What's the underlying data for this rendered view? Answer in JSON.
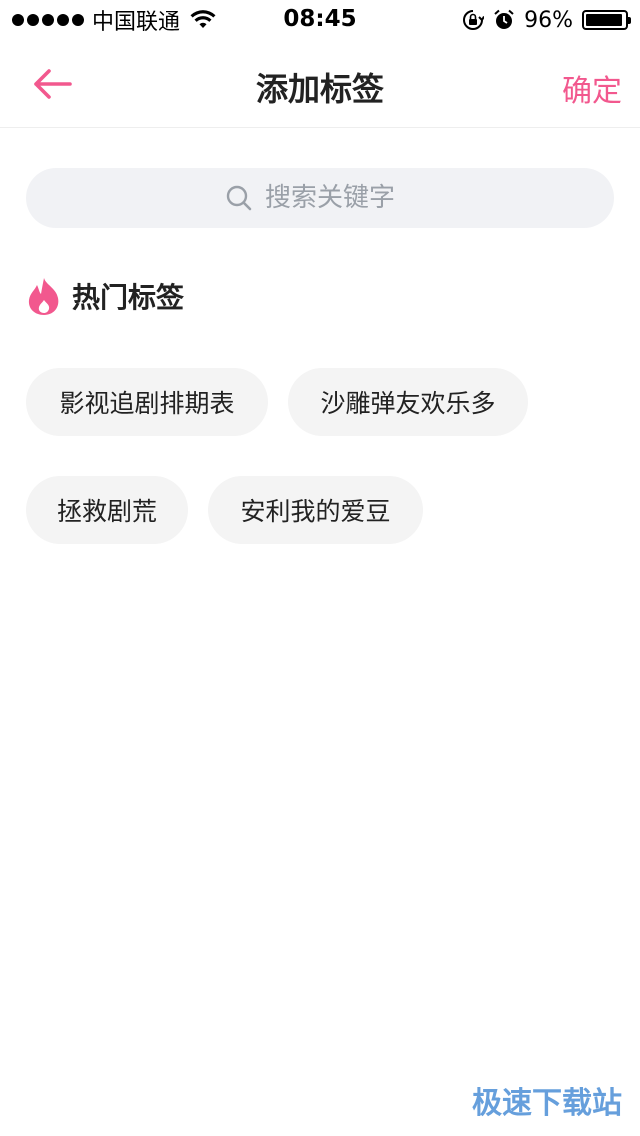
{
  "status_bar": {
    "carrier": "中国联通",
    "time": "08:45",
    "battery_percent": "96%",
    "battery_level": 0.96,
    "icons": [
      "signal-dots",
      "wifi-icon",
      "orientation-lock-icon",
      "alarm-icon",
      "battery-icon"
    ]
  },
  "nav": {
    "back_icon": "arrow-left-icon",
    "title": "添加标签",
    "confirm_label": "确定"
  },
  "search": {
    "placeholder": "搜索关键字",
    "icon": "search-icon"
  },
  "hot_tags": {
    "icon": "flame-icon",
    "title": "热门标签",
    "items": [
      {
        "label": "影视追剧排期表"
      },
      {
        "label": "沙雕弹友欢乐多"
      },
      {
        "label": "拯救剧荒"
      },
      {
        "label": "安利我的爱豆"
      }
    ]
  },
  "watermark": "极速下载站",
  "colors": {
    "accent": "#f2588e",
    "search_bg": "#f1f2f5",
    "tag_bg": "#f4f4f4",
    "text": "#222222",
    "placeholder": "#9aa0a8"
  }
}
